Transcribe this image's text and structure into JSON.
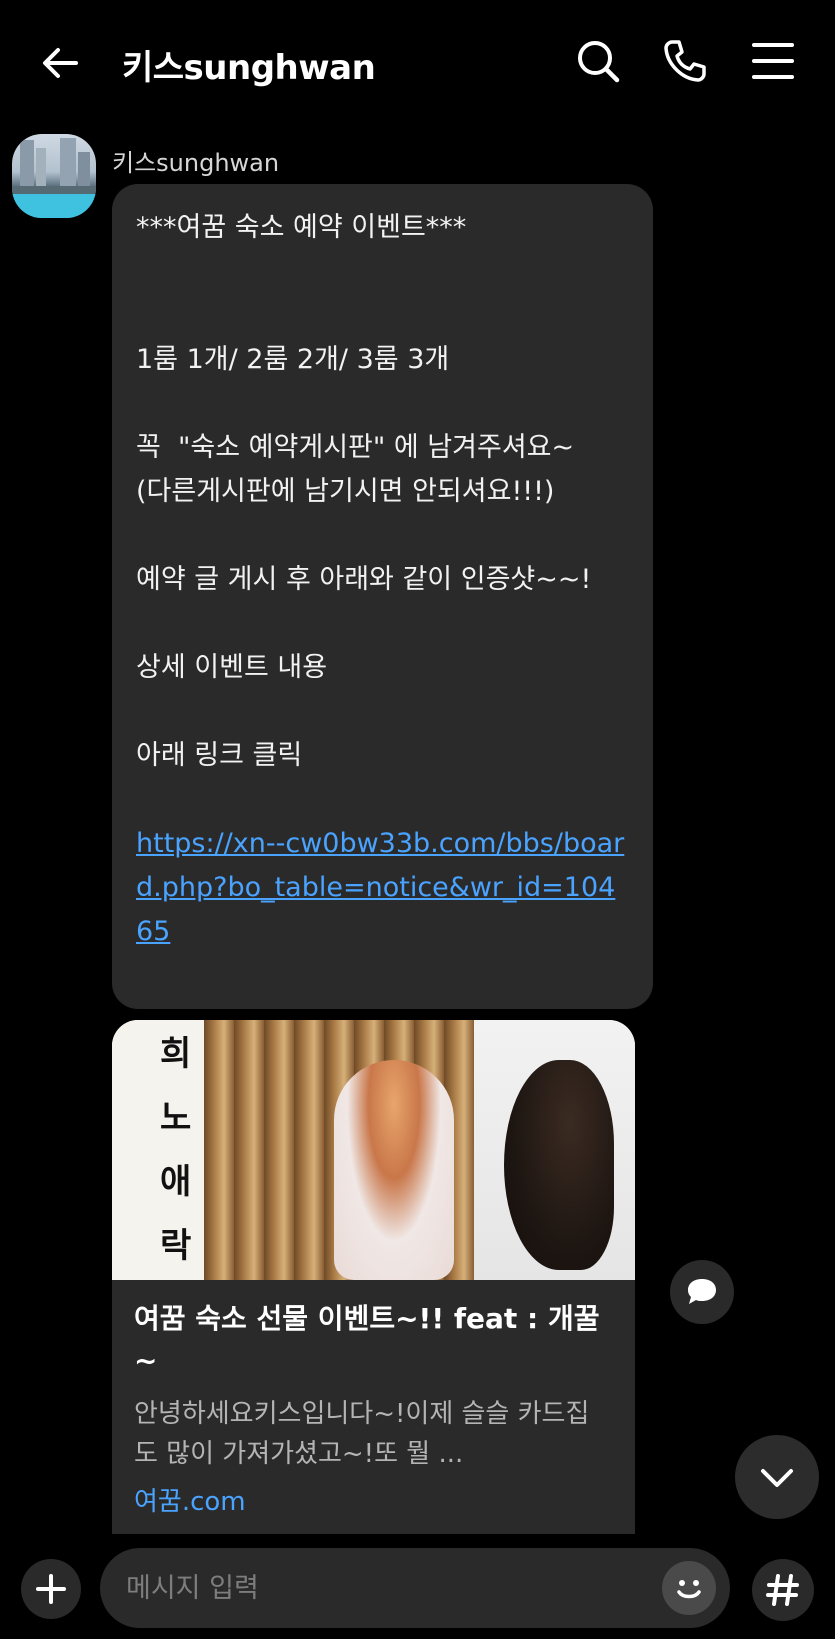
{
  "header": {
    "title": "키스sunghwan",
    "icons": [
      "back-arrow-icon",
      "search-icon",
      "phone-icon",
      "menu-icon"
    ]
  },
  "message": {
    "sender": "키스sunghwan",
    "lines": [
      "***여꿈 숙소 예약 이벤트***",
      "",
      "",
      "1룸 1개/ 2룸 2개/ 3룸 3개",
      "",
      "꼭  \"숙소 예약게시판\" 에 남겨주셔요~",
      "(다른게시판에 남기시면 안되셔요!!!)",
      "",
      "예약 글 게시 후 아래와 같이 인증샷~~!",
      "",
      "상세 이벤트 내용",
      "",
      "아래 링크 클릭",
      ""
    ],
    "link": "https://xn--cw0bw33b.com/bbs/board.php?bo_table=notice&wr_id=10465"
  },
  "link_preview": {
    "thumb_text": [
      "희",
      "노",
      "애",
      "락"
    ],
    "title": "여꿈 숙소 선물 이벤트~!! feat : 개꿀~",
    "description": "안녕하세요키스입니다~!이제 슬슬 카드집도 많이 가져가셨고~!또 뭘 ...",
    "domain": "여꿈.com"
  },
  "input": {
    "placeholder": "메시지 입력"
  },
  "colors": {
    "background": "#000000",
    "bubble": "#2a2a2a",
    "link": "#4aa3ff"
  }
}
